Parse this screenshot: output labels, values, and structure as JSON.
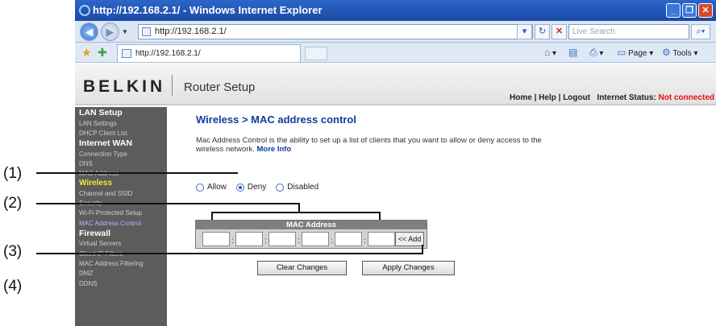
{
  "window": {
    "title": "http://192.168.2.1/ - Windows Internet Explorer",
    "url": "http://192.168.2.1/",
    "search_placeholder": "Live Search",
    "tab_label": "http://192.168.2.1/",
    "commands": {
      "page": "Page",
      "tools": "Tools"
    }
  },
  "header": {
    "logo": "BELKIN",
    "app_title": "Router Setup",
    "links": {
      "home": "Home",
      "help": "Help",
      "logout": "Logout"
    },
    "internet_status_label": "Internet Status:",
    "internet_status_value": "Not connected"
  },
  "sidebar": {
    "items": [
      {
        "label": "LAN Setup"
      },
      {
        "label": "LAN Settings"
      },
      {
        "label": "DHCP Client List"
      },
      {
        "label": "Internet WAN"
      },
      {
        "label": "Connection Type"
      },
      {
        "label": "DNS"
      },
      {
        "label": "MAC Address"
      },
      {
        "label": "Wireless"
      },
      {
        "label": "Channel and SSID"
      },
      {
        "label": "Security"
      },
      {
        "label": "Wi-Fi Protected Setup"
      },
      {
        "label": "MAC Address Control"
      },
      {
        "label": "Firewall"
      },
      {
        "label": "Virtual Servers"
      },
      {
        "label": "Client IP Filters"
      },
      {
        "label": "MAC Address Filtering"
      },
      {
        "label": "DMZ"
      },
      {
        "label": "DDNS"
      }
    ]
  },
  "main": {
    "title": "Wireless > MAC address control",
    "description": "Mac Address Control is the ability to set up a list of clients that you want to allow or deny access to the wireless network.",
    "more_info": "More Info",
    "modes": {
      "allow": "Allow",
      "deny": "Deny",
      "disabled": "Disabled",
      "selected": "Deny"
    },
    "mac_table": {
      "header": "MAC Address",
      "fields": [
        "",
        "",
        "",
        "",
        "",
        ""
      ],
      "add_label": "<< Add"
    },
    "buttons": {
      "clear": "Clear Changes",
      "apply": "Apply Changes"
    }
  },
  "callouts": [
    "(1)",
    "(2)",
    "(3)",
    "(4)"
  ]
}
